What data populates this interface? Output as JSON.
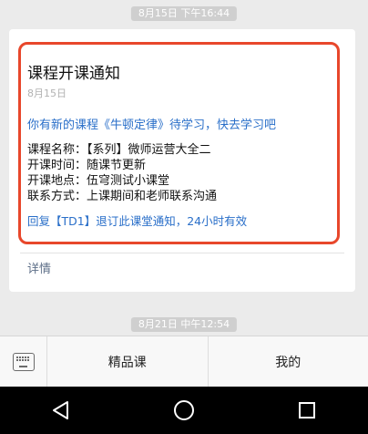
{
  "chat": {
    "timestamp_top": "8月15日 下午16:44",
    "timestamp_bottom": "8月21日 中午12:54"
  },
  "notice": {
    "title": "课程开课通知",
    "date": "8月15日",
    "intro": "你有新的课程《牛顿定律》待学习，快去学习吧",
    "rows": [
      "课程名称：【系列】微师运营大全二",
      "开课时间：随课节更新",
      "开课地点：伍穹测试小课堂",
      "联系方式：上课期间和老师联系沟通"
    ],
    "reply_hint": "回复【TD1】退订此课堂通知，24小时有效",
    "details_label": "详情",
    "highlight_color": "#e8472b"
  },
  "bottom_menu": {
    "keyboard_icon": "keyboard-icon",
    "items": [
      "精品课",
      "我的"
    ]
  },
  "system_nav": {
    "icons": [
      "back-icon",
      "home-icon",
      "recents-icon"
    ]
  }
}
